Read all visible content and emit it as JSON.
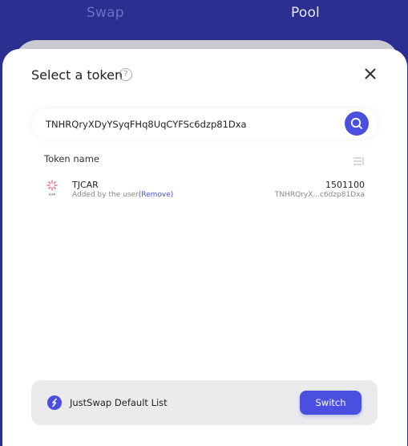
{
  "nav": {
    "swap": "Swap",
    "pool": "Pool"
  },
  "modal": {
    "title": "Select a token",
    "help_icon": "?",
    "search_value": "TNHRQryXDyYSyqFHq8UqCYFSc6dzp81Dxa",
    "list_header": "Token name",
    "tokens": [
      {
        "name": "TJCAR",
        "logo_text": "JCAR",
        "sub_prefix": "Added by the user",
        "remove_label": "(Remove)",
        "balance": "1501100",
        "address": "TNHRQryX...c6dzp81Dxa"
      }
    ],
    "footer": {
      "list_name": "JustSwap Default List",
      "switch_label": "Switch"
    }
  },
  "colors": {
    "accent": "#4a4fe0",
    "backdrop": "#2b2f8f",
    "error_underline": "#e0463c"
  },
  "icons": {
    "help": "help-icon",
    "close": "close-icon",
    "search": "search-icon",
    "sort": "sort-icon",
    "list": "justswap-logo-icon"
  }
}
